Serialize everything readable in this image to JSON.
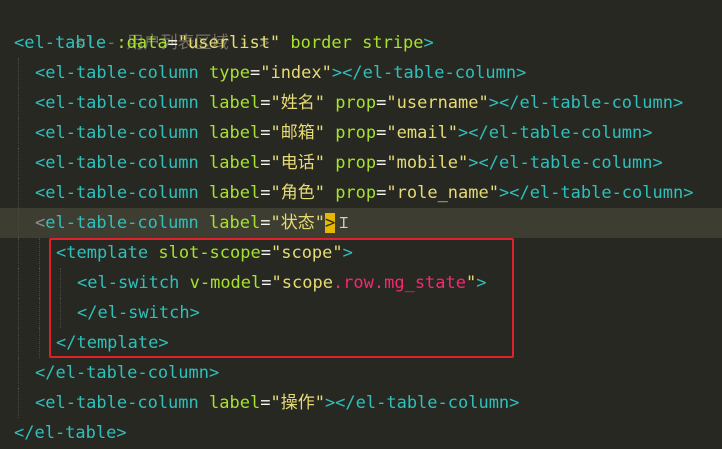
{
  "editor": {
    "lines": [
      {
        "t1": "<!-- 用户列表区域 -->"
      },
      {
        "t1": "<el-table",
        "t2": ":data",
        "t3": "=",
        "t4": "\"userlist\"",
        "t5": "border",
        "t6": "stripe",
        "t7": ">"
      },
      {
        "t1": "<el-table-column",
        "t2": "type",
        "t3": "=",
        "t4": "\"index\"",
        "t5": "></el-table-column>"
      },
      {
        "t1": "<el-table-column",
        "t2": "label",
        "t3": "=",
        "t4": "\"姓名\"",
        "t5": "prop",
        "t6": "=",
        "t7": "\"username\"",
        "t8": "></el-table-column>"
      },
      {
        "t1": "<el-table-column",
        "t2": "label",
        "t3": "=",
        "t4": "\"邮箱\"",
        "t5": "prop",
        "t6": "=",
        "t7": "\"email\"",
        "t8": "></el-table-column>"
      },
      {
        "t1": "<el-table-column",
        "t2": "label",
        "t3": "=",
        "t4": "\"电话\"",
        "t5": "prop",
        "t6": "=",
        "t7": "\"mobile\"",
        "t8": "></el-table-column>"
      },
      {
        "t1": "<el-table-column",
        "t2": "label",
        "t3": "=",
        "t4": "\"角色\"",
        "t5": "prop",
        "t6": "=",
        "t7": "\"role_name\"",
        "t8": "></el-table-column>"
      },
      {
        "t1": "<",
        "t2": "el-table-column",
        "t3": "label",
        "t4": "=",
        "t5": "\"状态\"",
        "t6": ">"
      },
      {
        "t1": "<template",
        "t2": "slot-scope",
        "t3": "=",
        "t4": "\"scope\"",
        "t5": ">"
      },
      {
        "t1": "<el-switch",
        "t2": "v-model",
        "t3": "=",
        "t4": "\"scope",
        "t5": ".row.mg_state",
        "t6": "\"",
        "t7": ">"
      },
      {
        "t1": "</el-switch>"
      },
      {
        "t1": "</template>"
      },
      {
        "t1": "</el-table-column>"
      },
      {
        "t1": "<el-table-column",
        "t2": "label",
        "t3": "=",
        "t4": "\"操作\"",
        "t5": "></el-table-column>"
      },
      {
        "t1": "</el-table>"
      }
    ]
  },
  "colors": {
    "background": "#272822",
    "tag": "#2fc0bc",
    "attribute": "#a6e22e",
    "string": "#e6db74",
    "comment": "#75715e",
    "highlight_box": "#e0202a",
    "bracket_match": "#e6b800"
  }
}
